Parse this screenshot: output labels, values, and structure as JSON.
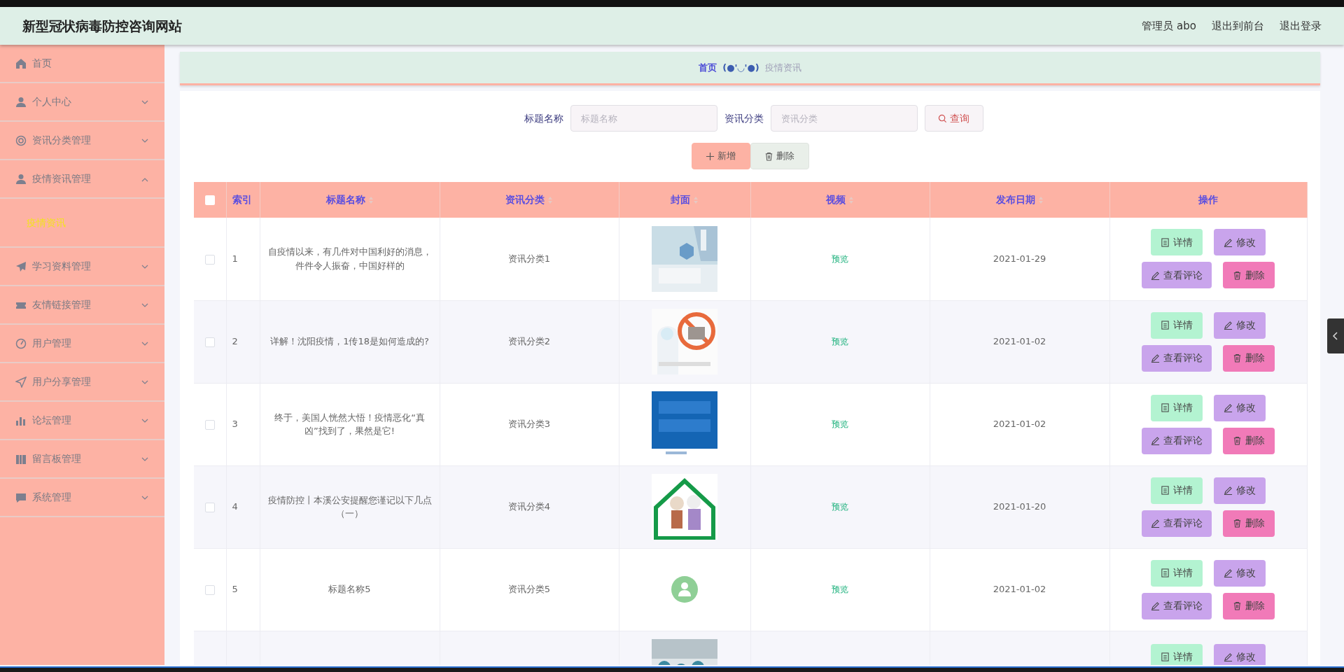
{
  "header": {
    "title": "新型冠状病毒防控咨询网站",
    "user": "管理员 abo",
    "links": [
      "退出到前台",
      "退出登录"
    ]
  },
  "sidebar": {
    "items": [
      {
        "label": "首页",
        "kind": "link"
      },
      {
        "label": "个人中心",
        "kind": "menu",
        "expanded": false
      },
      {
        "label": "资讯分类管理",
        "kind": "menu",
        "expanded": false
      },
      {
        "label": "疫情资讯管理",
        "kind": "menu",
        "expanded": true,
        "children": [
          {
            "label": "疫情资讯",
            "selected": true
          }
        ]
      },
      {
        "label": "学习资料管理",
        "kind": "menu",
        "expanded": false
      },
      {
        "label": "友情链接管理",
        "kind": "menu",
        "expanded": false
      },
      {
        "label": "用户管理",
        "kind": "menu",
        "expanded": false
      },
      {
        "label": "用户分享管理",
        "kind": "menu",
        "expanded": false
      },
      {
        "label": "论坛管理",
        "kind": "menu",
        "expanded": false
      },
      {
        "label": "留言板管理",
        "kind": "menu",
        "expanded": false
      },
      {
        "label": "系统管理",
        "kind": "menu",
        "expanded": false
      }
    ]
  },
  "breadcrumb": [
    "首页",
    "(●'◡'●)",
    "疫情资讯"
  ],
  "search": {
    "fields": [
      {
        "label": "标题名称",
        "placeholder": "标题名称"
      },
      {
        "label": "资讯分类",
        "placeholder": "资讯分类"
      }
    ],
    "button": "查询"
  },
  "actions": [
    {
      "label": "新增",
      "kind": "add"
    },
    {
      "label": "删除",
      "kind": "delete"
    }
  ],
  "table": {
    "select_all": {
      "checked": false
    },
    "columns": [
      {
        "label": "索引",
        "sortable": false
      },
      {
        "label": "标题名称",
        "sortable": true
      },
      {
        "label": "资讯分类",
        "sortable": true
      },
      {
        "label": "封面",
        "sortable": true
      },
      {
        "label": "视频",
        "sortable": true
      },
      {
        "label": "发布日期",
        "sortable": true
      },
      {
        "label": "操作",
        "sortable": false
      }
    ],
    "rows": [
      {
        "checked": false,
        "index": "1",
        "title": "自疫情以来，有几件对中国利好的消息，件件令人振奋，中国好样的",
        "category": "资讯分类1",
        "cover": {
          "kind": "picture"
        },
        "video": "预览",
        "date": "2021-01-29",
        "actions": [
          {
            "label": "详情",
            "kind": "detail"
          },
          {
            "label": "修改",
            "kind": "edit"
          },
          {
            "label": "查看评论",
            "kind": "comments"
          },
          {
            "label": "删除",
            "kind": "delete"
          }
        ]
      },
      {
        "checked": false,
        "index": "2",
        "title": "详解！沈阳疫情，1传18是如何造成的?",
        "category": "资讯分类2",
        "cover": {
          "kind": "picture"
        },
        "video": "预览",
        "date": "2021-01-02",
        "actions": [
          {
            "label": "详情",
            "kind": "detail"
          },
          {
            "label": "修改",
            "kind": "edit"
          },
          {
            "label": "查看评论",
            "kind": "comments"
          },
          {
            "label": "删除",
            "kind": "delete"
          }
        ]
      },
      {
        "checked": false,
        "index": "3",
        "title": "终于，美国人恍然大悟！疫情恶化“真凶”找到了，果然是它!",
        "category": "资讯分类3",
        "cover": {
          "kind": "picture"
        },
        "video": "预览",
        "date": "2021-01-02",
        "actions": [
          {
            "label": "详情",
            "kind": "detail"
          },
          {
            "label": "修改",
            "kind": "edit"
          },
          {
            "label": "查看评论",
            "kind": "comments"
          },
          {
            "label": "删除",
            "kind": "delete"
          }
        ]
      },
      {
        "checked": false,
        "index": "4",
        "title": "疫情防控丨本溪公安提醒您谨记以下几点（一）",
        "category": "资讯分类4",
        "cover": {
          "kind": "picture"
        },
        "video": "预览",
        "date": "2021-01-20",
        "actions": [
          {
            "label": "详情",
            "kind": "detail"
          },
          {
            "label": "修改",
            "kind": "edit"
          },
          {
            "label": "查看评论",
            "kind": "comments"
          },
          {
            "label": "删除",
            "kind": "delete"
          }
        ]
      },
      {
        "checked": false,
        "index": "5",
        "title": "标题名称5",
        "category": "资讯分类5",
        "cover": {
          "kind": "icon"
        },
        "video": "预览",
        "date": "2021-01-02",
        "actions": [
          {
            "label": "详情",
            "kind": "detail"
          },
          {
            "label": "修改",
            "kind": "edit"
          },
          {
            "label": "查看评论",
            "kind": "comments"
          },
          {
            "label": "删除",
            "kind": "delete"
          }
        ]
      },
      {
        "cover": {
          "kind": "picture"
        },
        "actions": [
          {
            "label": "详情",
            "kind": "detail"
          },
          {
            "label": "修改",
            "kind": "edit"
          }
        ]
      }
    ]
  }
}
